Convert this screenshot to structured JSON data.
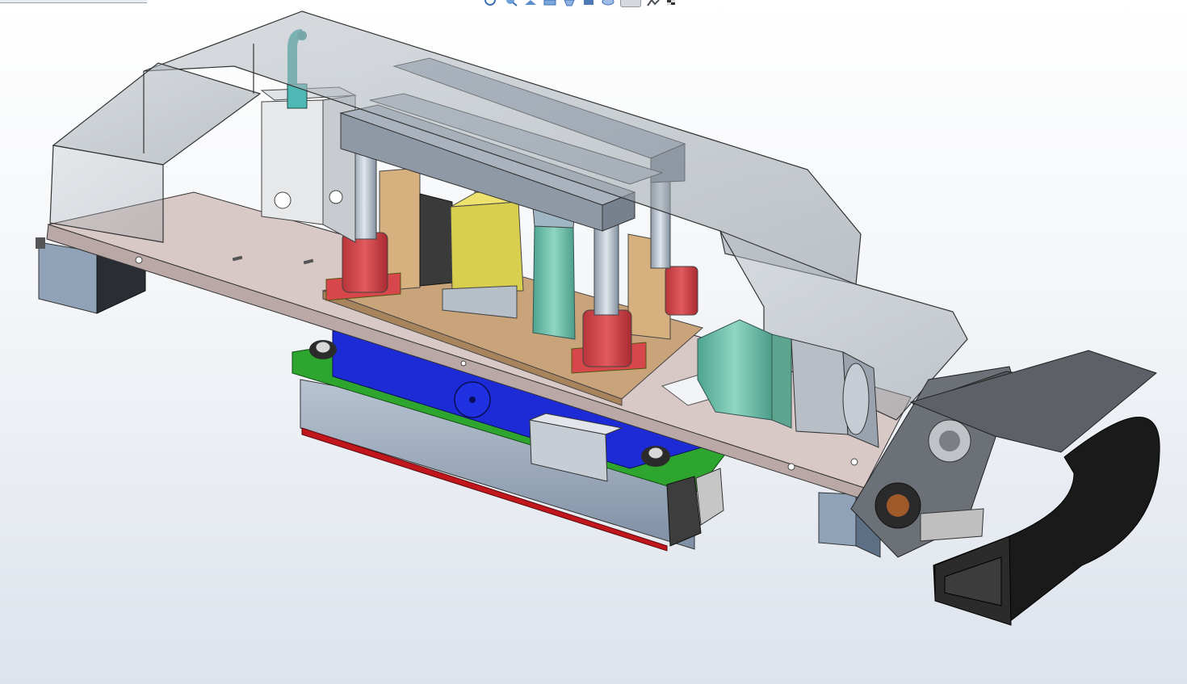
{
  "colors": {
    "background_top": "#ffffff",
    "background_bottom": "#dde3ec",
    "plate": "#d9c9c6",
    "guard": "#9aa4ad",
    "cylinder_red": "#d6464a",
    "bracket_tan": "#c9a47a",
    "yellow_block": "#d9cf4f",
    "teal_part": "#6fbfaa",
    "blue_frame": "#1c2bd6",
    "green_frame": "#2ea52e",
    "steel": "#8a9aae",
    "dark_metal": "#55585c",
    "cable_chain": "#1a1a1a",
    "blade_red": "#c0161c"
  },
  "toolbar": {
    "icons": [
      "zoom-fit-icon",
      "zoom-area-icon",
      "previous-view-icon",
      "section-view-icon",
      "view-orientation-icon",
      "display-style-icon",
      "hide-show-icon",
      "appearance-icon",
      "scene-icon",
      "view-settings-icon"
    ]
  }
}
